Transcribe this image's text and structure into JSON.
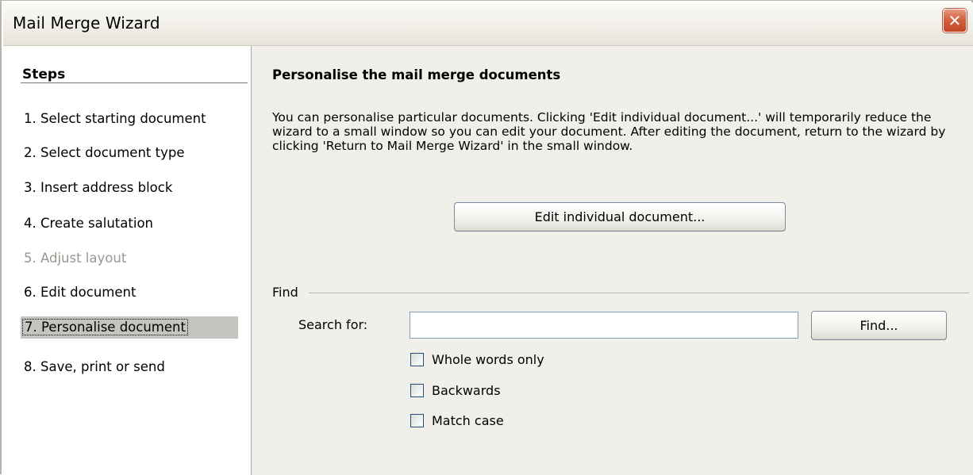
{
  "window": {
    "title": "Mail Merge Wizard",
    "close_glyph": "✕"
  },
  "sidebar": {
    "title": "Steps",
    "items": [
      {
        "label": "1. Select starting document",
        "state": "normal"
      },
      {
        "label": "2. Select document type",
        "state": "normal"
      },
      {
        "label": "3. Insert address block",
        "state": "normal"
      },
      {
        "label": "4. Create salutation",
        "state": "normal"
      },
      {
        "label": "5. Adjust layout",
        "state": "disabled"
      },
      {
        "label": "6. Edit document",
        "state": "normal"
      },
      {
        "label": "7. Personalise document",
        "state": "active"
      },
      {
        "label": "8. Save, print or send",
        "state": "normal"
      }
    ]
  },
  "main": {
    "heading": "Personalise the mail merge documents",
    "description": "You can personalise particular documents. Clicking 'Edit individual document...' will temporarily reduce the wizard to a small window so you can edit your document. After editing the document, return to the wizard by clicking 'Return to Mail Merge Wizard' in the small window.",
    "edit_button_label": "Edit individual document...",
    "find": {
      "group_label": "Find",
      "search_label": "Search for:",
      "search_value": "",
      "find_button_label": "Find...",
      "options": [
        {
          "label": "Whole words only",
          "checked": false
        },
        {
          "label": "Backwards",
          "checked": false
        },
        {
          "label": "Match case",
          "checked": false
        }
      ]
    }
  },
  "colors": {
    "panel_bg": "#f0efea",
    "selected_step_bg": "#c6c4c0",
    "close_button": "#d35c3c",
    "disabled_text": "#9a978f"
  }
}
